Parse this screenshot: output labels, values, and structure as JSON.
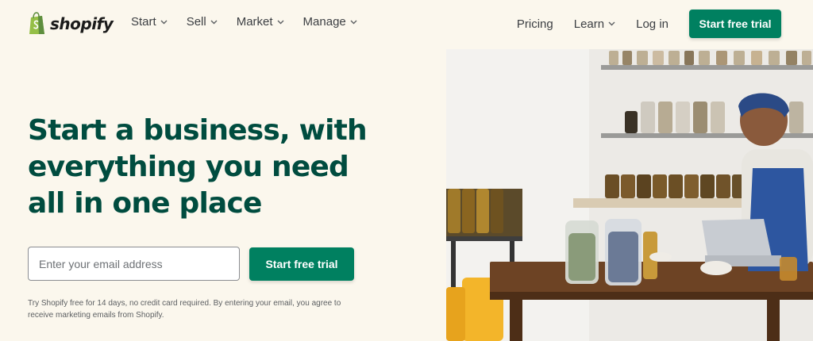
{
  "header": {
    "logo_text": "shopify",
    "nav_left": [
      {
        "label": "Start"
      },
      {
        "label": "Sell"
      },
      {
        "label": "Market"
      },
      {
        "label": "Manage"
      }
    ],
    "pricing_label": "Pricing",
    "learn_label": "Learn",
    "login_label": "Log in",
    "cta_label": "Start free trial"
  },
  "hero": {
    "title_line1": "Start a business, with",
    "title_line2": "everything you need",
    "title_line3": "all in one place",
    "email_placeholder": "Enter your email address",
    "cta_label": "Start free trial",
    "disclaimer_line1": "Try Shopify free for 14 days, no credit card required. By entering your email, you agree to",
    "disclaimer_line2": "receive marketing emails from Shopify."
  },
  "colors": {
    "background": "#fbf7ed",
    "brand_green": "#008060",
    "heading_green": "#004c3f",
    "logo_green": "#95bf47"
  },
  "icons": {
    "logo": "shopify-bag-icon",
    "dropdown": "chevron-down-icon"
  }
}
